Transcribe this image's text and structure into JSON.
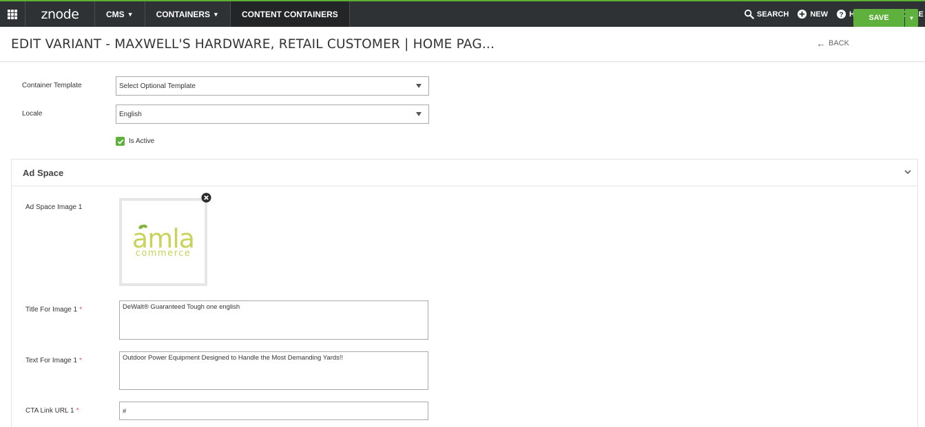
{
  "nav": {
    "logo": "znode",
    "items": [
      {
        "label": "CMS",
        "dropdown": true
      },
      {
        "label": "CONTAINERS",
        "dropdown": true
      },
      {
        "label": "CONTENT CONTAINERS",
        "dropdown": false
      }
    ],
    "right": {
      "search": "SEARCH",
      "new": "NEW",
      "help": "HELP",
      "profile": "PROFILE"
    }
  },
  "header": {
    "title": "EDIT VARIANT  -  MAXWELL'S HARDWARE, RETAIL CUSTOMER | HOME PAG...",
    "back": "BACK",
    "save": "SAVE"
  },
  "form": {
    "container_template": {
      "label": "Container Template",
      "value": "Select Optional Template"
    },
    "locale": {
      "label": "Locale",
      "value": "English"
    },
    "is_active": {
      "label": "Is Active",
      "checked": true
    }
  },
  "ad_space": {
    "title": "Ad Space",
    "image_label": "Ad Space Image 1",
    "image_logo_text": "amla",
    "image_logo_sub": "commerce",
    "title_label": "Title For Image 1",
    "title_value": "DeWalt® Guaranteed Tough one english",
    "text_label": "Text For Image 1",
    "text_value": "Outdoor Power Equipment Designed to Handle the Most Demanding Yards!!",
    "cta_label": "CTA Link URL 1",
    "cta_value": "#",
    "required_mark": "*"
  },
  "colors": {
    "nav_bg": "#2f3234",
    "accent_green": "#5db13c",
    "logo_green": "#c8d35a",
    "required_red": "#d9534f"
  }
}
